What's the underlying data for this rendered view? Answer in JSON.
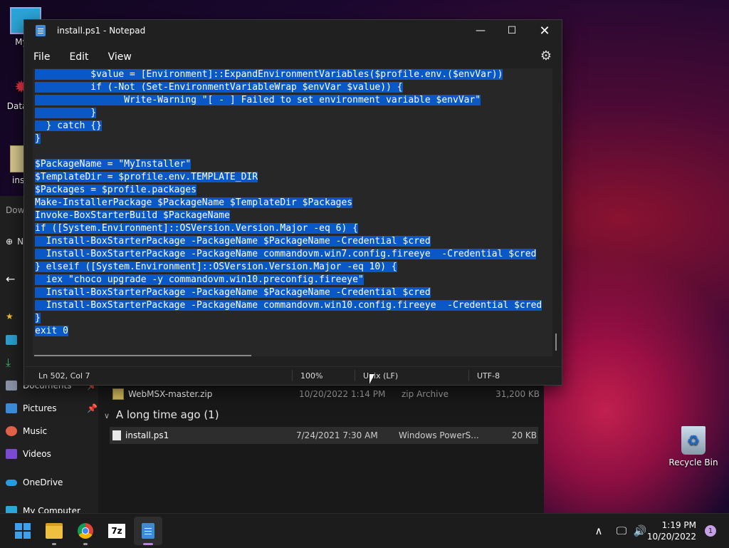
{
  "notepad": {
    "title": "install.ps1 - Notepad",
    "menu": [
      "File",
      "Edit",
      "View"
    ],
    "code_lines": [
      "          $value = [Environment]::ExpandEnvironmentVariables($profile.env.($envVar))",
      "          if (-Not (Set-EnvironmentVariableWrap $envVar $value)) {",
      "                Write-Warning \"[ - ] Failed to set environment variable $envVar\"",
      "          }",
      "  } catch {}",
      "}",
      "",
      "$PackageName = \"MyInstaller\"",
      "$TemplateDir = $profile.env.TEMPLATE_DIR",
      "$Packages = $profile.packages",
      "Make-InstallerPackage $PackageName $TemplateDir $Packages",
      "Invoke-BoxStarterBuild $PackageName",
      "if ([System.Environment]::OSVersion.Version.Major -eq 6) {",
      "  Install-BoxStarterPackage -PackageName $PackageName -Credential $cred",
      "  Install-BoxStarterPackage -PackageName commandovm.win7.config.fireeye  -Credential $cred",
      "} elseif ([System.Environment]::OSVersion.Version.Major -eq 10) {",
      "  iex \"choco upgrade -y commandovm.win10.preconfig.fireeye\"",
      "  Install-BoxStarterPackage -PackageName $PackageName -Credential $cred",
      "  Install-BoxStarterPackage -PackageName commandovm.win10.config.fireeye  -Credential $cred",
      "}",
      "exit 0"
    ],
    "status": {
      "position": "Ln 502, Col 7",
      "zoom": "100%",
      "line_ending": "Unix (LF)",
      "encoding": "UTF-8"
    }
  },
  "explorer": {
    "sidebar": [
      {
        "label": "Dow",
        "icon": "download-icon"
      },
      {
        "label": "N",
        "icon": "new-icon"
      },
      {
        "label": "Documents",
        "icon": "documents-icon"
      },
      {
        "label": "Pictures",
        "icon": "pictures-icon"
      },
      {
        "label": "Music",
        "icon": "music-icon"
      },
      {
        "label": "Videos",
        "icon": "videos-icon"
      },
      {
        "label": "OneDrive",
        "icon": "onedrive-icon"
      },
      {
        "label": "My Computer",
        "icon": "computer-icon"
      }
    ],
    "files_top": {
      "name": "WebMSX-master.zip",
      "date": "10/20/2022 1:14 PM",
      "type": "zip Archive",
      "size": "31,200 KB"
    },
    "group_label": "A long time ago (1)",
    "files_old": {
      "name": "install.ps1",
      "date": "7/24/2021 7:30 AM",
      "type": "Windows PowerS...",
      "size": "20 KB"
    }
  },
  "desktop": {
    "icons": [
      "My C",
      "DataW",
      "inst"
    ],
    "recycle_bin": "Recycle Bin"
  },
  "taskbar": {
    "apps": [
      "start-icon",
      "file-explorer-icon",
      "chrome-icon",
      "7zip-icon",
      "notepad-icon"
    ],
    "time": "1:19 PM",
    "date": "10/20/2022",
    "notification_count": "1"
  }
}
